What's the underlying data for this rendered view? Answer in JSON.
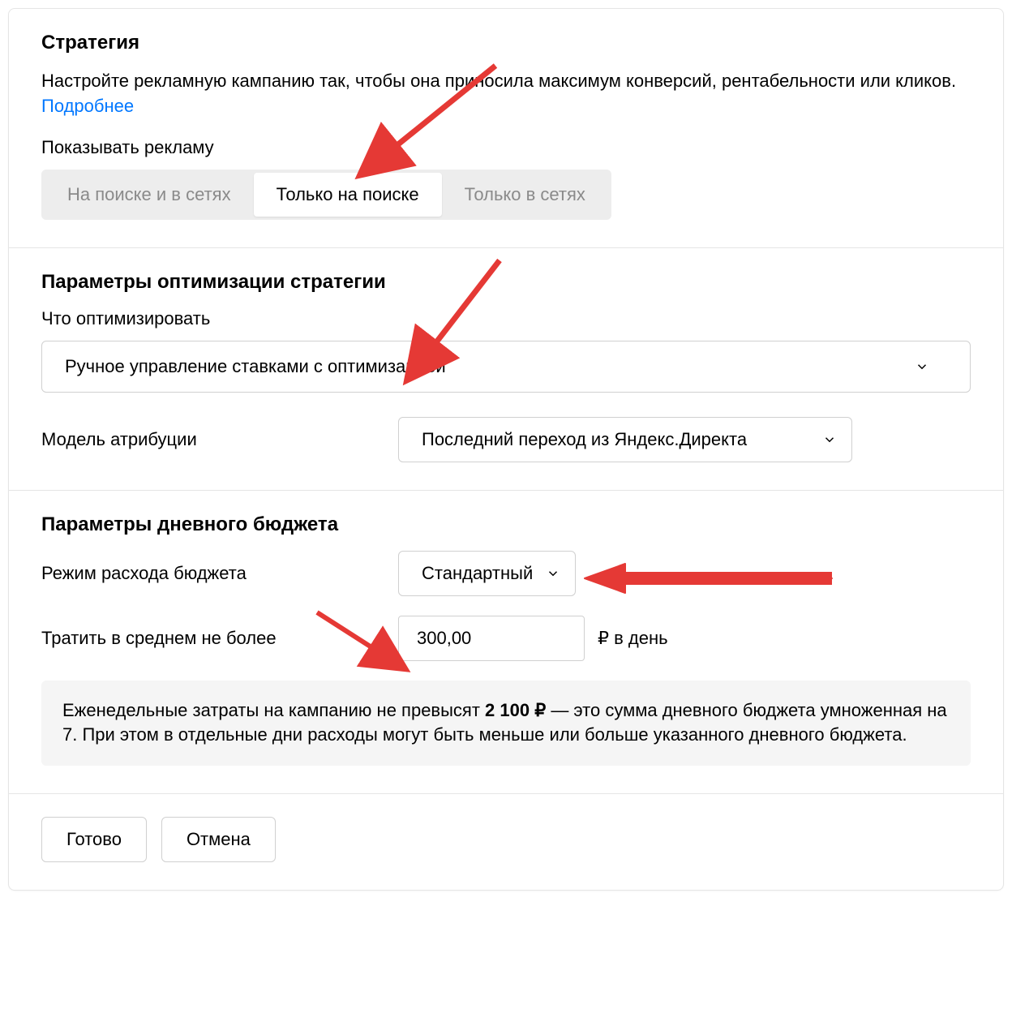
{
  "strategy": {
    "title": "Стратегия",
    "desc_part1": "Настройте рекламную кампанию так, чтобы она приносила максимум конверсий, рентабельности или кликов. ",
    "more_link": "Подробнее",
    "show_label": "Показывать рекламу",
    "segments": {
      "both": "На поиске и в сетях",
      "search": "Только на поиске",
      "networks": "Только в сетях"
    }
  },
  "optim": {
    "title": "Параметры оптимизации стратегии",
    "what_label": "Что оптимизировать",
    "what_value": "Ручное управление ставками с оптимизацией",
    "attr_label": "Модель атрибуции",
    "attr_value": "Последний переход из Яндекс.Директа"
  },
  "budget": {
    "title": "Параметры дневного бюджета",
    "mode_label": "Режим расхода бюджета",
    "mode_value": "Стандартный",
    "spend_label": "Тратить в среднем не более",
    "spend_value": "300,00",
    "spend_unit": "₽ в день",
    "note_pre": "Еженедельные затраты на кампанию не превысят ",
    "note_bold": "2 100 ₽",
    "note_post": " — это сумма дневного бюджета умноженная на 7. При этом в отдельные дни расходы могут быть меньше или больше указанного дневного бюджета."
  },
  "footer": {
    "done": "Готово",
    "cancel": "Отмена"
  }
}
